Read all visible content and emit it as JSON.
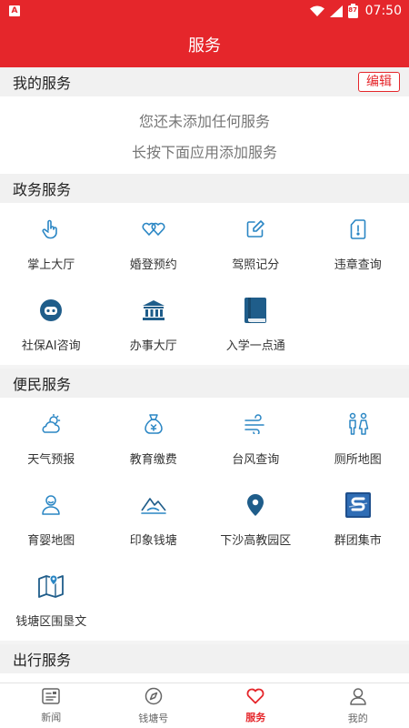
{
  "status": {
    "time": "07:50",
    "battery": "87",
    "app_badge": "A"
  },
  "header": {
    "title": "服务"
  },
  "my_services": {
    "title": "我的服务",
    "edit_label": "编辑",
    "empty_line1": "您还未添加任何服务",
    "empty_line2": "长按下面应用添加服务"
  },
  "gov": {
    "title": "政务服务",
    "items": [
      {
        "label": "掌上大厅",
        "icon": "hand-pointer-icon"
      },
      {
        "label": "婚登预约",
        "icon": "double-heart-icon"
      },
      {
        "label": "驾照记分",
        "icon": "edit-note-icon"
      },
      {
        "label": "违章查询",
        "icon": "sim-alert-icon"
      },
      {
        "label": "社保AI咨询",
        "icon": "robot-icon"
      },
      {
        "label": "办事大厅",
        "icon": "bank-building-icon"
      },
      {
        "label": "入学一点通",
        "icon": "book-icon"
      }
    ]
  },
  "life": {
    "title": "便民服务",
    "items": [
      {
        "label": "天气预报",
        "icon": "weather-icon"
      },
      {
        "label": "教育缴费",
        "icon": "money-bag-icon"
      },
      {
        "label": "台风查询",
        "icon": "wind-icon"
      },
      {
        "label": "厕所地图",
        "icon": "toilet-icon"
      },
      {
        "label": "育婴地图",
        "icon": "baby-icon"
      },
      {
        "label": "印象钱塘",
        "icon": "mountain-icon"
      },
      {
        "label": "下沙高教园区",
        "icon": "location-pin-icon"
      },
      {
        "label": "群团集市",
        "icon": "market-logo-icon"
      },
      {
        "label": "钱塘区围垦文",
        "icon": "map-icon"
      }
    ]
  },
  "travel": {
    "title": "出行服务"
  },
  "tabs": [
    {
      "label": "新闻",
      "icon": "news-icon"
    },
    {
      "label": "钱塘号",
      "icon": "compass-icon"
    },
    {
      "label": "服务",
      "icon": "heart-icon",
      "active": true
    },
    {
      "label": "我的",
      "icon": "user-icon"
    }
  ],
  "colors": {
    "brand": "#e5262b",
    "icon_blue": "#2a86c4",
    "icon_dark": "#1f5d8a"
  }
}
